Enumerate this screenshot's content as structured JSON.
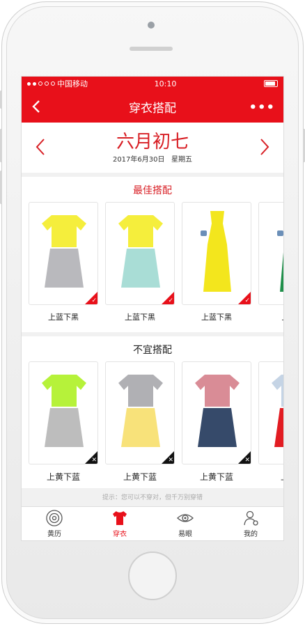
{
  "status": {
    "carrier": "中国移动",
    "time": "10:10"
  },
  "nav": {
    "title": "穿衣搭配",
    "more_label": "•••"
  },
  "date": {
    "lunar": "六月初七",
    "solar": "2017年6月30日   星期五"
  },
  "best": {
    "title": "最佳搭配",
    "items": [
      {
        "caption": "上蓝下黑",
        "top_color": "#f5ee3c",
        "bottom_color": "#b9b9bd"
      },
      {
        "caption": "上蓝下黑",
        "top_color": "#f5ee3c",
        "bottom_color": "#a9ddd6"
      },
      {
        "caption": "上蓝下黑",
        "top_color": "#f3e61d",
        "bottom_color": "#f3e61d"
      },
      {
        "caption": "上蓝下",
        "top_color": "#1f8f4a",
        "bottom_color": "#1f8f4a"
      }
    ]
  },
  "bad": {
    "title": "不宜搭配",
    "items": [
      {
        "caption": "上黄下蓝",
        "top_color": "#b6f23a",
        "bottom_color": "#bdbdbd"
      },
      {
        "caption": "上黄下蓝",
        "top_color": "#b0b0b4",
        "bottom_color": "#f8e27a"
      },
      {
        "caption": "上黄下蓝",
        "top_color": "#d98c96",
        "bottom_color": "#364a6a"
      },
      {
        "caption": "上黄下",
        "top_color": "#c5d4e5",
        "bottom_color": "#e21c22"
      }
    ]
  },
  "tip": "提示：您可以不穿对，但千万别穿错",
  "tabs": [
    {
      "label": "黄历",
      "icon": "calendar-dial-icon"
    },
    {
      "label": "穿衣",
      "icon": "tshirt-icon"
    },
    {
      "label": "易眼",
      "icon": "eye-icon"
    },
    {
      "label": "我的",
      "icon": "user-icon"
    }
  ],
  "colors": {
    "accent": "#e8101a"
  }
}
